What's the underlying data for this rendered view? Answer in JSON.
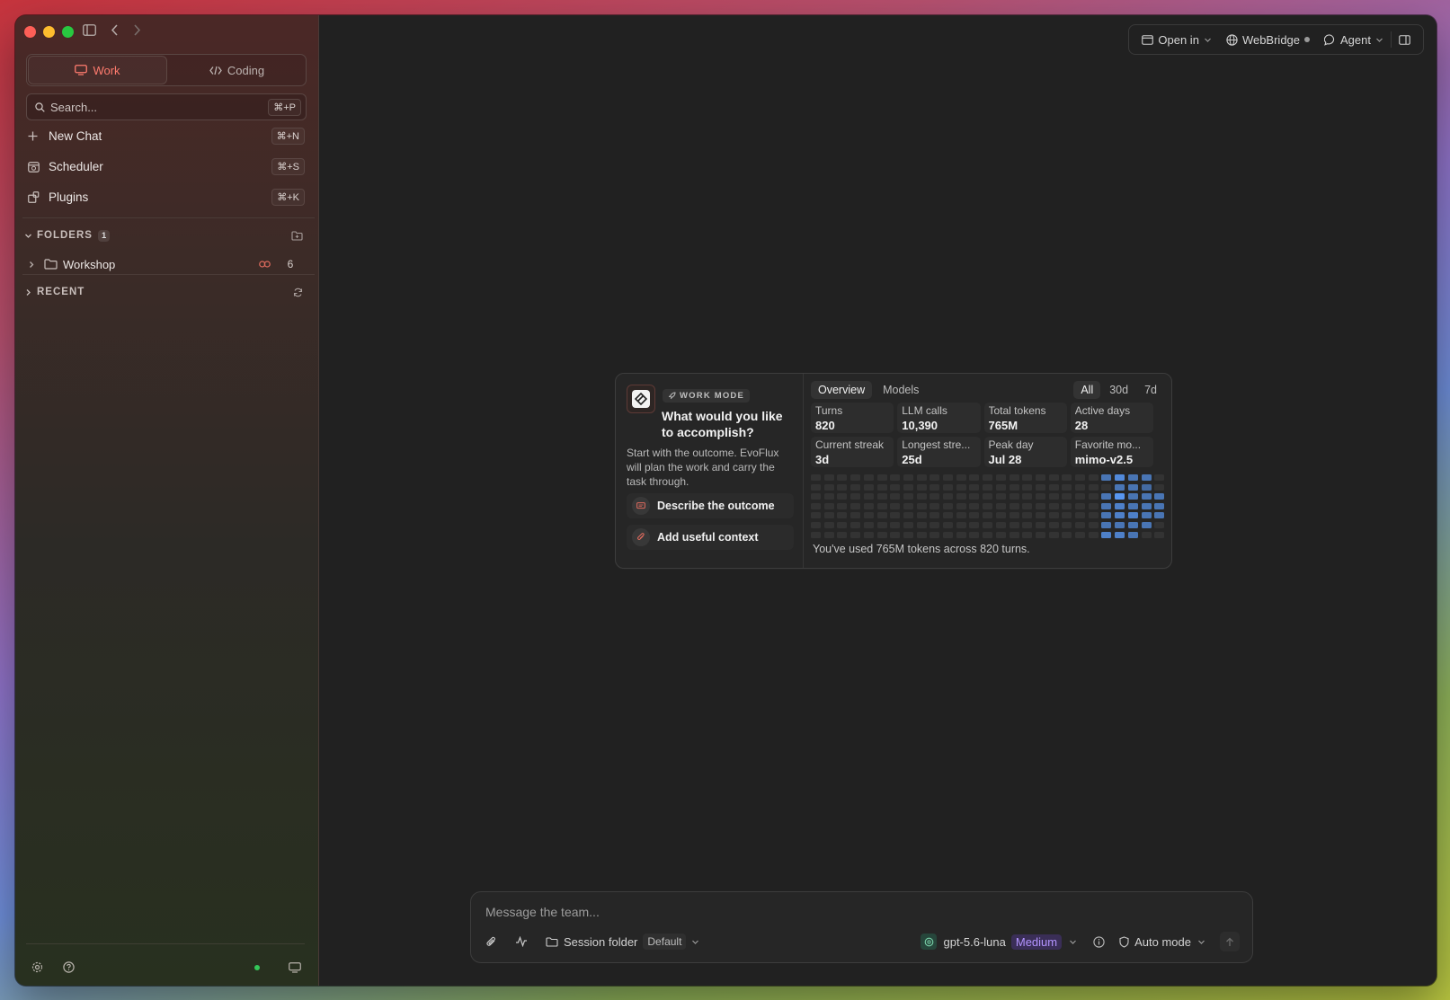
{
  "sidebar": {
    "modes": [
      {
        "label": "Work",
        "active": true
      },
      {
        "label": "Coding",
        "active": false
      }
    ],
    "search": {
      "placeholder": "Search...",
      "shortcut": "⌘+P"
    },
    "nav": [
      {
        "label": "New Chat",
        "shortcut": "⌘+N",
        "icon": "plus-icon"
      },
      {
        "label": "Scheduler",
        "shortcut": "⌘+S",
        "icon": "calendar-icon"
      },
      {
        "label": "Plugins",
        "shortcut": "⌘+K",
        "icon": "puzzle-icon"
      }
    ],
    "folders": {
      "title": "FOLDERS",
      "count": "1",
      "items": [
        {
          "name": "Workshop",
          "count": "6"
        }
      ]
    },
    "recent": {
      "title": "RECENT"
    }
  },
  "toolbar": {
    "open_in": "Open in",
    "webbridge": "WebBridge",
    "agent": "Agent"
  },
  "card": {
    "tag": "WORK MODE",
    "title": "What would you like to accomplish?",
    "description": "Start with the outcome. EvoFlux will plan the work and carry the task through.",
    "actions": [
      {
        "label": "Describe the outcome"
      },
      {
        "label": "Add useful context"
      }
    ],
    "tabs": [
      {
        "label": "Overview",
        "active": true
      },
      {
        "label": "Models",
        "active": false
      }
    ],
    "ranges": [
      {
        "label": "All",
        "active": true
      },
      {
        "label": "30d",
        "active": false
      },
      {
        "label": "7d",
        "active": false
      }
    ],
    "stats": [
      {
        "label": "Turns",
        "value": "820"
      },
      {
        "label": "LLM calls",
        "value": "10,390"
      },
      {
        "label": "Total tokens",
        "value": "765M"
      },
      {
        "label": "Active days",
        "value": "28"
      },
      {
        "label": "Current streak",
        "value": "3d"
      },
      {
        "label": "Longest stre...",
        "value": "25d"
      },
      {
        "label": "Peak day",
        "value": "Jul 28"
      },
      {
        "label": "Favorite mo...",
        "value": "mimo-v2.5"
      }
    ],
    "heatmap": {
      "columns": 26,
      "rows": 7,
      "active": [
        [
          22,
          0,
          0.55
        ],
        [
          22,
          1,
          0
        ],
        [
          22,
          2,
          0.55
        ],
        [
          22,
          3,
          0.55
        ],
        [
          22,
          4,
          0.55
        ],
        [
          22,
          5,
          0.55
        ],
        [
          22,
          6,
          0.7
        ],
        [
          23,
          0,
          0.85
        ],
        [
          23,
          1,
          0.55
        ],
        [
          23,
          2,
          1.0
        ],
        [
          23,
          3,
          0.7
        ],
        [
          23,
          4,
          0.7
        ],
        [
          23,
          5,
          0.55
        ],
        [
          23,
          6,
          0.7
        ],
        [
          24,
          0,
          0.55
        ],
        [
          24,
          1,
          0.55
        ],
        [
          24,
          2,
          0.55
        ],
        [
          24,
          3,
          0.55
        ],
        [
          24,
          4,
          0.7
        ],
        [
          24,
          5,
          0.55
        ],
        [
          24,
          6,
          0.55
        ],
        [
          25,
          0,
          0.55
        ],
        [
          25,
          1,
          0.4
        ],
        [
          25,
          2,
          0.55
        ],
        [
          25,
          3,
          0.55
        ],
        [
          25,
          4,
          0.55
        ],
        [
          25,
          5,
          0.55
        ],
        [
          26,
          2,
          0.55
        ],
        [
          26,
          3,
          0.55
        ],
        [
          26,
          4,
          0.55
        ]
      ]
    },
    "footnote": "You've used 765M tokens across 820 turns."
  },
  "composer": {
    "placeholder": "Message the team...",
    "session_folder": "Session folder",
    "folder_value": "Default",
    "model": "gpt-5.6-luna",
    "effort": "Medium",
    "mode": "Auto mode"
  }
}
